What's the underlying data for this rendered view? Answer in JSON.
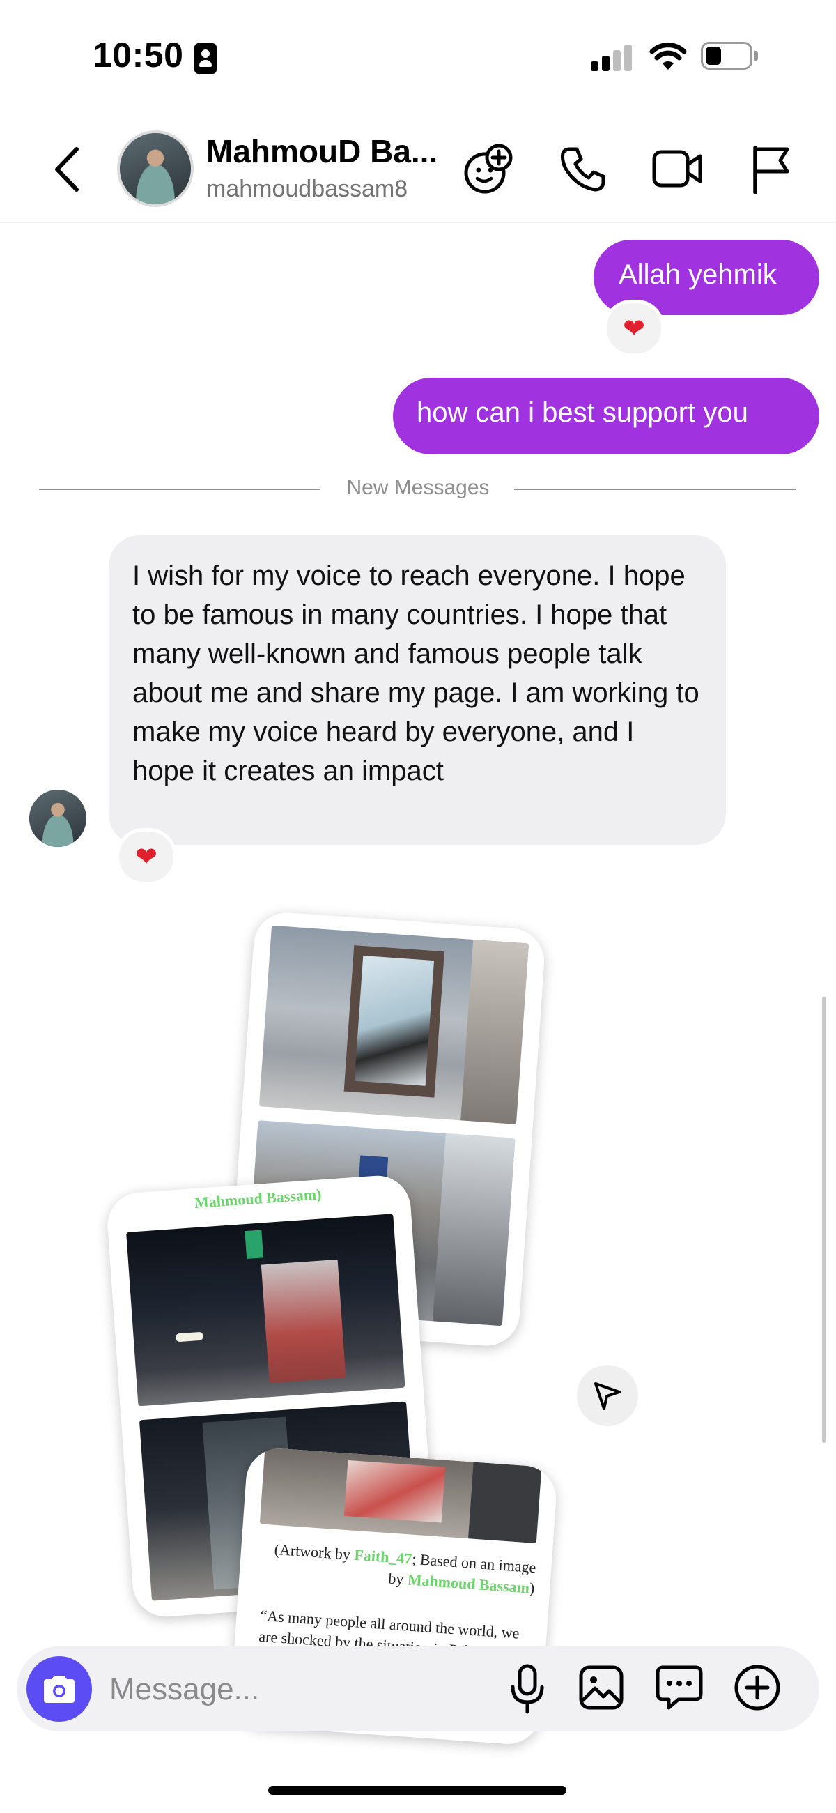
{
  "status_bar": {
    "time": "10:50"
  },
  "header": {
    "back_icon": "chevron-left-icon",
    "contact_name": "MahmouD Ba...",
    "contact_handle": "mahmoudbassam8",
    "actions": [
      "add-person-icon",
      "phone-icon",
      "video-icon",
      "flag-icon"
    ]
  },
  "messages": {
    "sent_1": {
      "text": "Allah yehmik",
      "reaction": "❤"
    },
    "sent_2": {
      "text": "how can i best support you"
    },
    "separator": "New Messages",
    "received_1": {
      "text": "I wish for my voice to reach everyone. I hope to be famous in many countries. I hope that many well-known and famous people talk about me and share my page. I am working to make my voice heard by everyone, and I hope it creates an impact",
      "reaction": "❤"
    }
  },
  "shared_post": {
    "card_middle_caption": "Mahmoud Bassam)",
    "card_front_caption_prefix": "(Artwork by ",
    "card_front_artist": "Faith_47",
    "card_front_caption_middle": "; Based on an image by ",
    "card_front_photographer": "Mahmoud Bassam",
    "card_front_caption_suffix": ")",
    "card_front_quote": "“As many people all around the world, we are shocked by the situation in Palestine, and I..."
  },
  "composer": {
    "placeholder": "Message...",
    "icons": [
      "camera-icon",
      "microphone-icon",
      "gallery-icon",
      "sticker-icon",
      "plus-icon"
    ]
  },
  "colors": {
    "sent_bubble": "#a032e0",
    "received_bubble": "#efeff1",
    "camera_button": "#5b4df3",
    "reaction_heart": "#e0202d"
  }
}
